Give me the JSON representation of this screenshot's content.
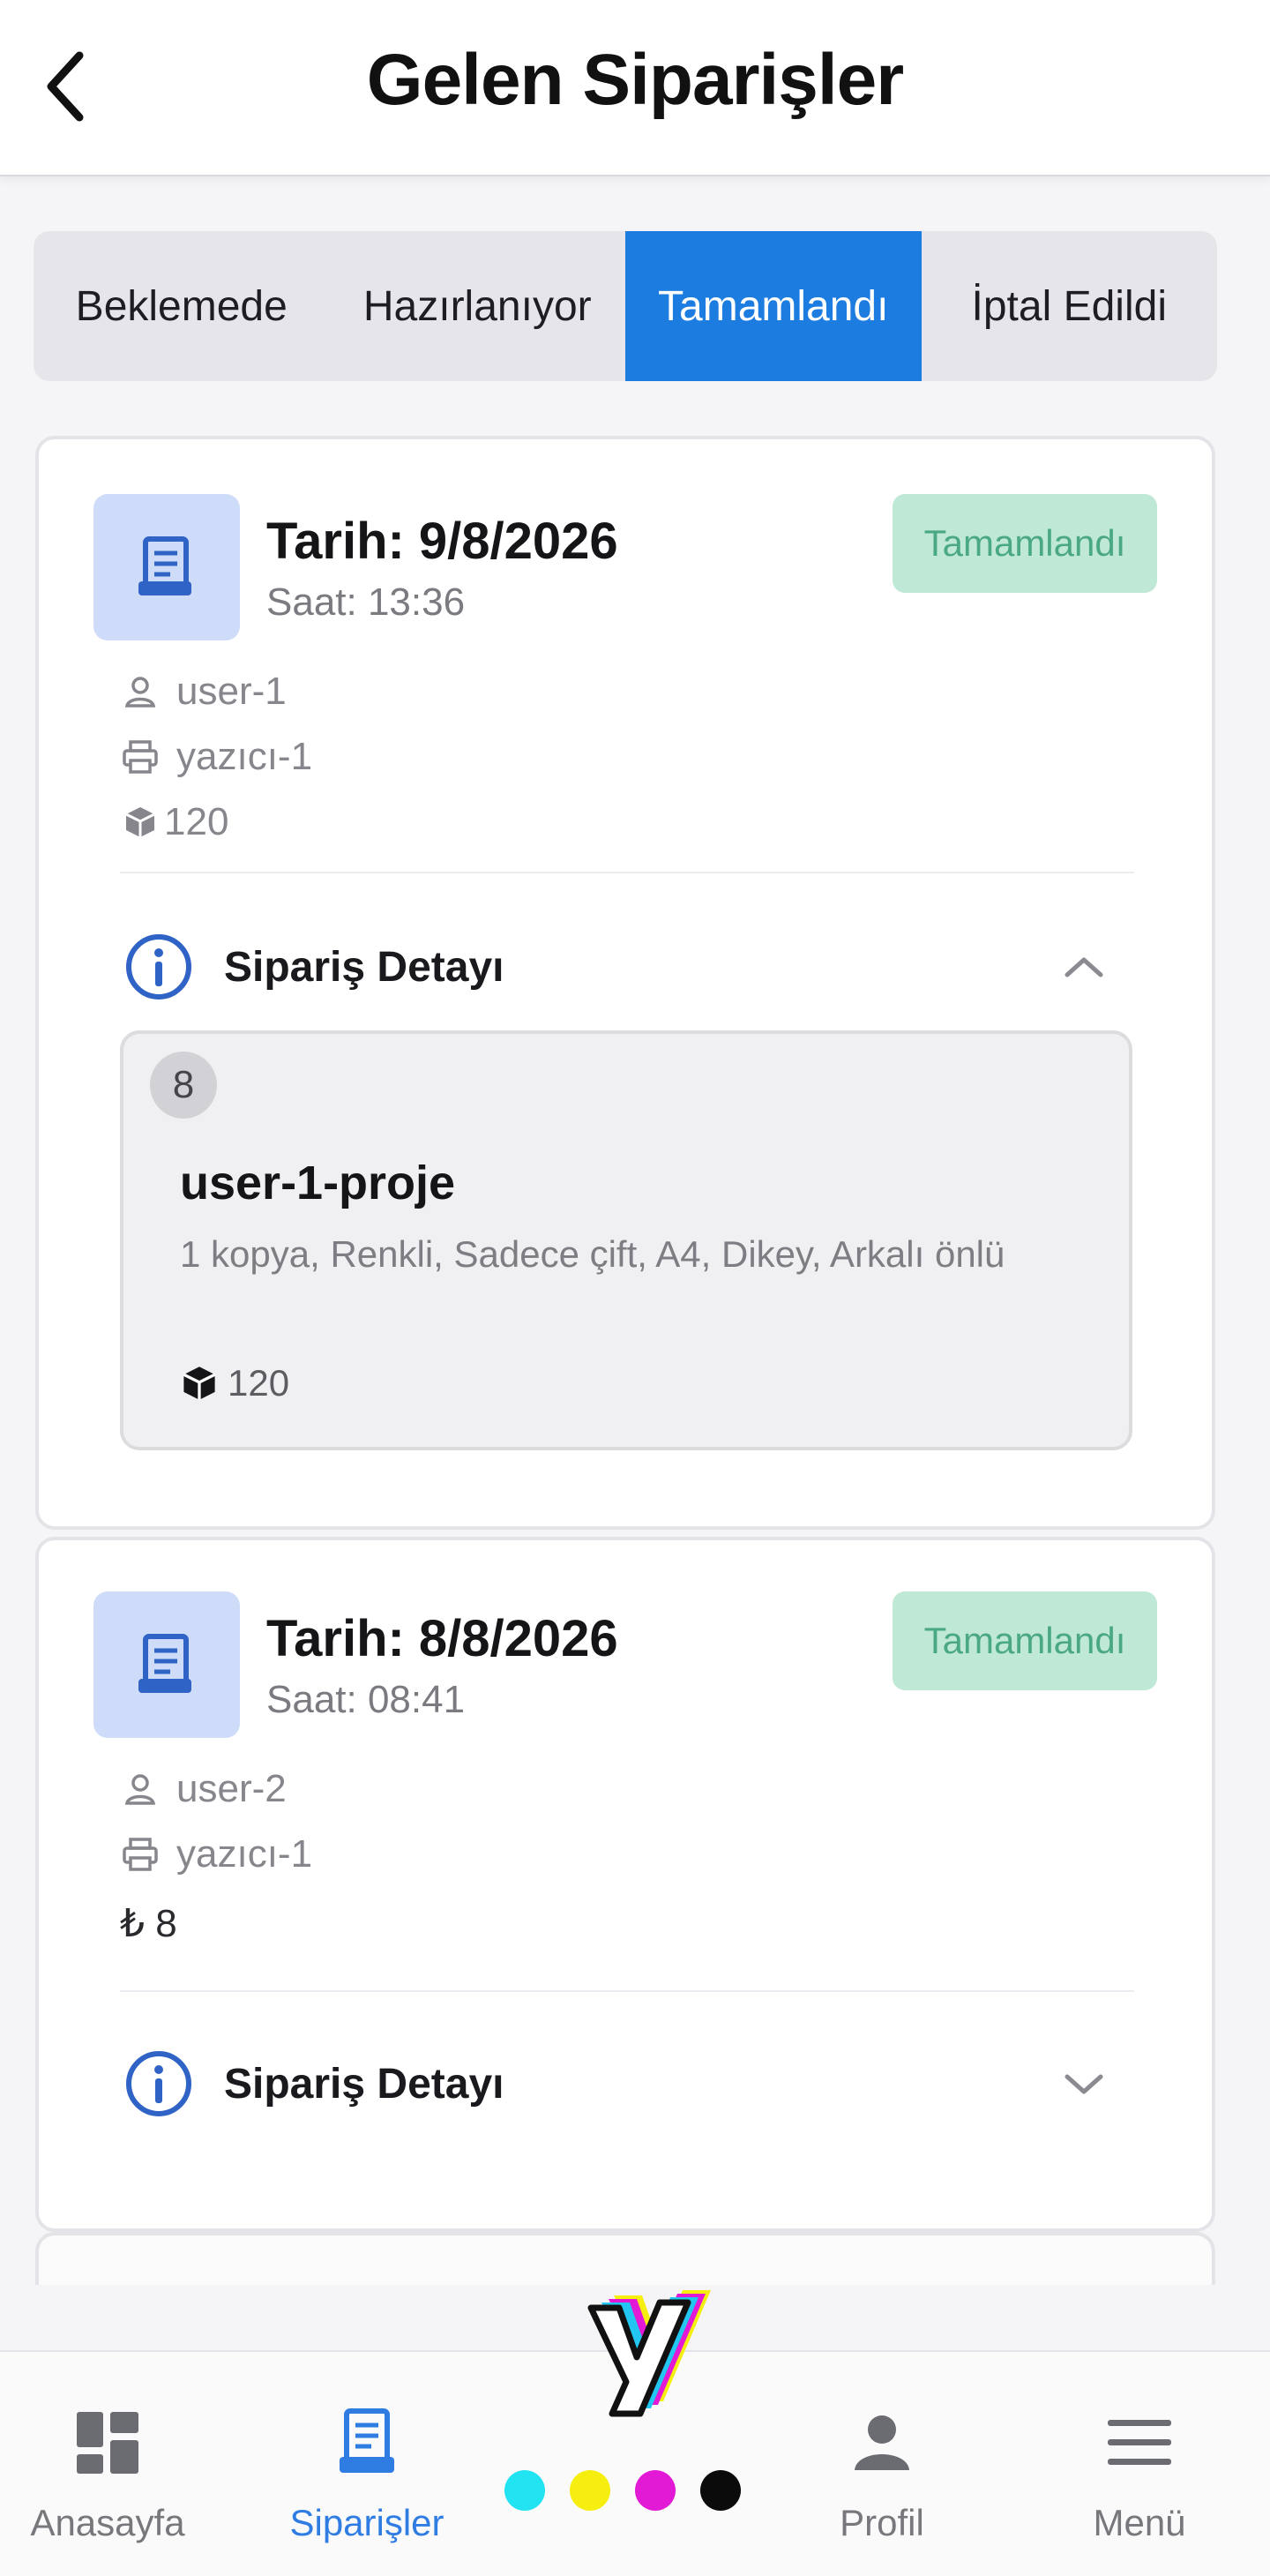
{
  "header": {
    "title": "Gelen Siparişler",
    "back_icon": "chevron-left-icon"
  },
  "tabs": [
    {
      "label": "Beklemede",
      "active": false
    },
    {
      "label": "Hazırlanıyor",
      "active": false
    },
    {
      "label": "Tamamlandı",
      "active": true
    },
    {
      "label": "İptal Edildi",
      "active": false
    }
  ],
  "orders": [
    {
      "date": "Tarih: 9/8/2026",
      "time": "Saat: 13:36",
      "status": "Tamamlandı",
      "user": "user-1",
      "printer": "yazıcı-1",
      "amount": "120",
      "amount_icon": "cube-icon",
      "detail_label": "Sipariş Detayı",
      "expanded": true,
      "items": [
        {
          "count": "8",
          "name": "user-1-proje",
          "description": "1 kopya, Renkli, Sadece çift, A4, Dikey, Arkalı önlü",
          "price": "120"
        }
      ]
    },
    {
      "date": "Tarih: 8/8/2026",
      "time": "Saat: 08:41",
      "status": "Tamamlandı",
      "user": "user-2",
      "printer": "yazıcı-1",
      "amount": "₺ 8",
      "amount_icon": "lira-icon",
      "detail_label": "Sipariş Detayı",
      "expanded": false,
      "items": []
    }
  ],
  "bottom_nav": [
    {
      "label": "Anasayfa",
      "icon": "dashboard-icon",
      "active": false
    },
    {
      "label": "Siparişler",
      "icon": "receipt-icon",
      "active": true
    },
    {
      "label": "Profil",
      "icon": "person-icon",
      "active": false
    },
    {
      "label": "Menü",
      "icon": "hamburger-menu-icon",
      "active": false
    }
  ],
  "colors": {
    "accent": "#1c7ce0",
    "status_bg": "#bfe9d6",
    "status_text": "#4aa882",
    "icon_bg": "#cfdcf9",
    "dot_cyan": "#22e3f2",
    "dot_yellow": "#f5ee0f",
    "dot_magenta": "#e21ad6",
    "dot_black": "#0b0b0b"
  }
}
